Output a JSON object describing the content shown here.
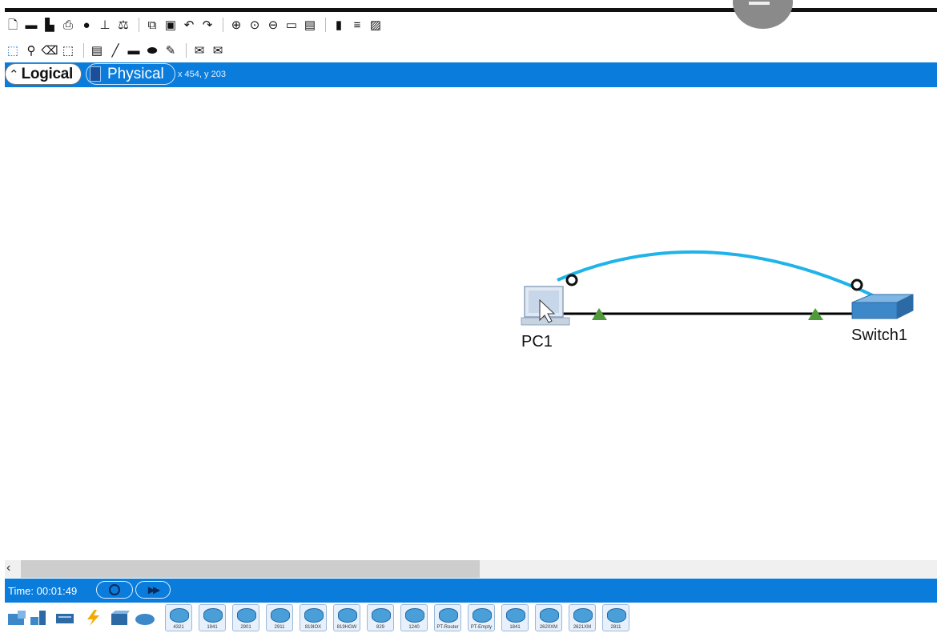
{
  "tabs": {
    "logical_label": "Logical",
    "physical_label": "Physical",
    "coordinates": "x 454, y 203"
  },
  "toolbar_main": {
    "icons": [
      "new-file-icon",
      "open-folder-icon",
      "save-icon",
      "print-icon",
      "info-icon",
      "activity-wizard-icon",
      "custom-device-icon",
      "copy-icon",
      "paste-icon",
      "undo-icon",
      "redo-icon",
      "zoom-in-icon",
      "zoom-reset-icon",
      "zoom-out-icon",
      "drawing-palette-icon",
      "custom-devices-dialog-icon",
      "viewport-icon",
      "list-icon",
      "screenshot-icon"
    ]
  },
  "toolbar_draw": {
    "icons": [
      "select-icon",
      "inspect-icon",
      "delete-icon",
      "resize-icon",
      "note-icon",
      "line-icon",
      "rectangle-icon",
      "ellipse-icon",
      "freeform-icon",
      "simple-pdu-icon",
      "complex-pdu-icon"
    ]
  },
  "canvas": {
    "devices": [
      {
        "name": "PC1",
        "type": "pc"
      },
      {
        "name": "Switch1",
        "type": "switch"
      }
    ],
    "links": [
      {
        "type": "console",
        "color": "#1fb3ea",
        "status": "down"
      },
      {
        "type": "copper-straight-through",
        "color": "#000000",
        "status": "up"
      }
    ]
  },
  "realtime": {
    "time_text": "Time: 00:01:49"
  },
  "device_palette": {
    "categories": [
      "network-devices-icon",
      "end-devices-icon",
      "components-icon",
      "connections-icon",
      "miscellaneous-icon",
      "multiuser-icon"
    ],
    "routers": [
      "4321",
      "1941",
      "2901",
      "2911",
      "819IOX",
      "819HGW",
      "829",
      "1240",
      "PT-Router",
      "PT-Empty",
      "1841",
      "2620XM",
      "2621XM",
      "2811"
    ]
  },
  "colors": {
    "accent_bar": "#0a7cdc",
    "console_cable": "#1fb3ea",
    "link_up": "#4f9a3a"
  }
}
